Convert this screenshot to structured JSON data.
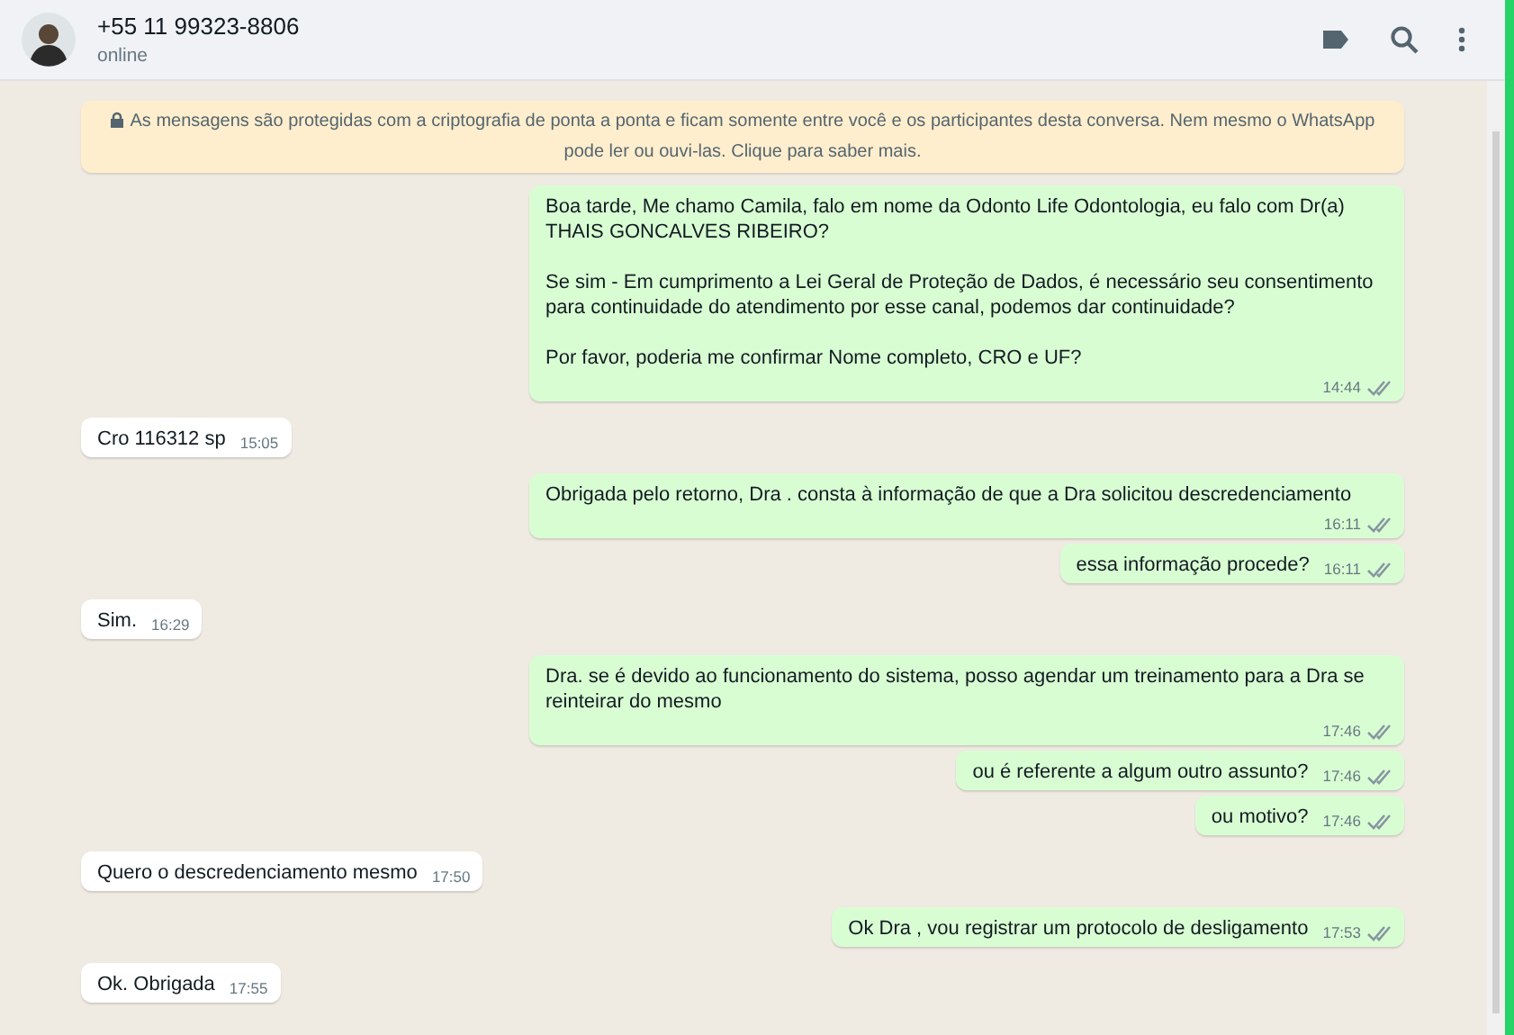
{
  "header": {
    "title": "+55 11 99323-8806",
    "status": "online"
  },
  "notice": "As mensagens são protegidas com a criptografia de ponta a ponta e ficam somente entre você e os participantes desta conversa. Nem mesmo o WhatsApp pode ler ou ouvi-las. Clique para saber mais.",
  "messages": [
    {
      "kind": "outgoing",
      "text": "Boa tarde, Me chamo Camila, falo em nome da Odonto Life Odontologia, eu falo com Dr(a) THAIS GONCALVES RIBEIRO?\n\nSe sim - Em cumprimento a Lei Geral de Proteção de Dados, é necessário seu consentimento para continuidade do atendimento por esse canal, podemos dar continuidade?\n\nPor favor, poderia me confirmar Nome completo, CRO e UF?",
      "time": "14:44"
    },
    {
      "kind": "incoming",
      "text": "Cro 116312 sp",
      "time": "15:05"
    },
    {
      "kind": "outgoing",
      "text": "Obrigada pelo retorno, Dra . consta à informação de que a Dra solicitou descredenciamento",
      "time": "16:11"
    },
    {
      "kind": "outgoing",
      "text": "essa informação procede?",
      "time": "16:11"
    },
    {
      "kind": "incoming",
      "text": "Sim.",
      "time": "16:29"
    },
    {
      "kind": "outgoing",
      "text": "Dra. se é devido ao funcionamento do sistema, posso agendar um treinamento para a Dra se reinteirar do mesmo",
      "time": "17:46"
    },
    {
      "kind": "outgoing",
      "text": "ou é referente a algum outro assunto?",
      "time": "17:46"
    },
    {
      "kind": "outgoing",
      "text": "ou motivo?",
      "time": "17:46"
    },
    {
      "kind": "incoming",
      "text": "Quero o descredenciamento mesmo",
      "time": "17:50"
    },
    {
      "kind": "outgoing",
      "text": "Ok Dra , vou registrar um protocolo de desligamento",
      "time": "17:53"
    },
    {
      "kind": "incoming",
      "text": "Ok. Obrigada",
      "time": "17:55"
    }
  ]
}
